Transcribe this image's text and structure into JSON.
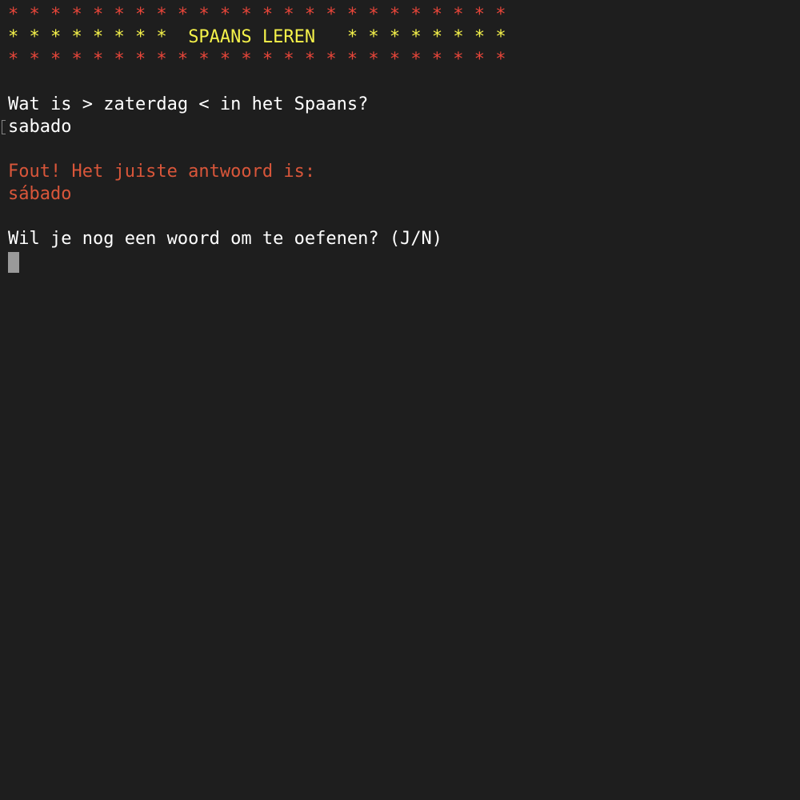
{
  "banner": {
    "top_border": "* * * * * * * * * * * * * * * * * * * * * * * *",
    "title_left_stars": "* * * * * * * *",
    "title": "SPAANS LEREN",
    "title_right_stars": "* * * * * * * *",
    "bottom_border": "* * * * * * * * * * * * * * * * * * * * * * * *"
  },
  "question": {
    "prompt": "Wat is > zaterdag < in het Spaans?",
    "user_answer": "sabado"
  },
  "feedback": {
    "message": "Fout! Het juiste antwoord is:",
    "correct_answer": "sábado"
  },
  "continue_prompt": "Wil je nog een woord om te oefenen? (J/N)",
  "colors": {
    "background": "#1e1e1e",
    "border_stars": "#e8463a",
    "title": "#f5f24a",
    "error": "#d9563a",
    "cursor": "#9a9a9a"
  }
}
